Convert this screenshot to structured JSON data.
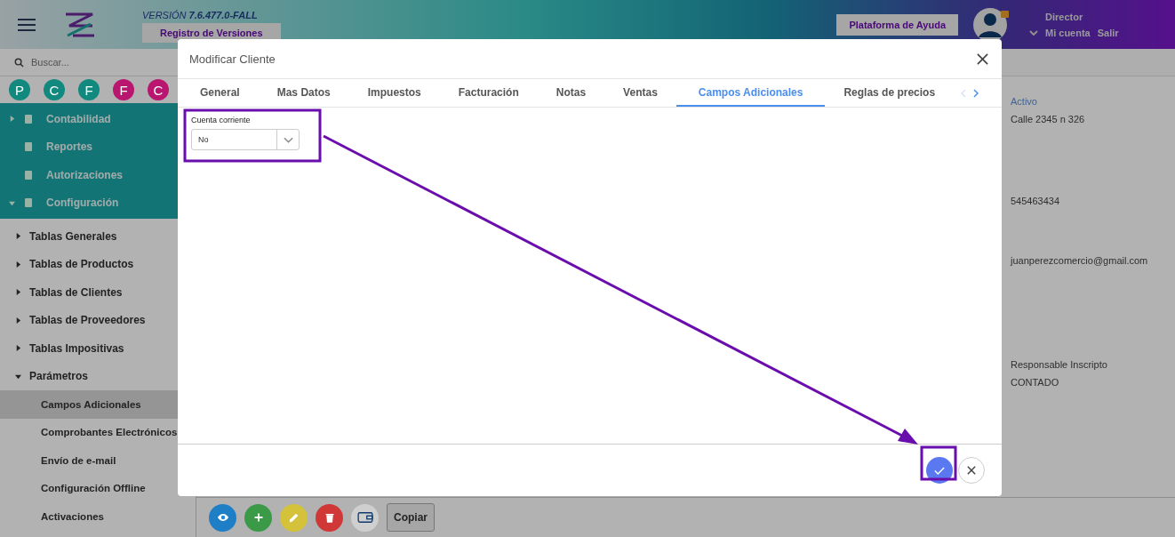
{
  "header": {
    "version": "VERSIÓN **7.6.477.0-FALL**",
    "versions_button": "Registro de Versiones",
    "help_button": "Plataforma de Ayuda",
    "user": {
      "role": "Director",
      "links": [
        "Mi cuenta",
        "Salir"
      ]
    }
  },
  "sidebar": {
    "search": {
      "placeholder": "Buscar..."
    },
    "shortcuts": [
      {
        "letter": "P",
        "color": "#12897f"
      },
      {
        "letter": "C",
        "color": "#12897f"
      },
      {
        "letter": "F",
        "color": "#12897f"
      },
      {
        "letter": "F",
        "color": "#b8166f"
      },
      {
        "letter": "C",
        "color": "#b8166f"
      }
    ],
    "menu": [
      {
        "label": "Contabilidad",
        "kind": "group",
        "expanded": false,
        "selected": false
      },
      {
        "label": "Reportes",
        "kind": "link",
        "selected": false
      },
      {
        "label": "Autorizaciones",
        "kind": "link",
        "selected": false
      },
      {
        "label": "Configuración",
        "kind": "group",
        "expanded": true,
        "selected": false,
        "children": [
          {
            "label": "Tablas Generales",
            "kind": "group",
            "expanded": false,
            "selected": false
          },
          {
            "label": "Tablas de Productos",
            "kind": "group",
            "expanded": false,
            "selected": false
          },
          {
            "label": "Tablas de Clientes",
            "kind": "group",
            "expanded": false,
            "selected": false
          },
          {
            "label": "Tablas de Proveedores",
            "kind": "group",
            "expanded": false,
            "selected": false
          },
          {
            "label": "Tablas Impositivas",
            "kind": "group",
            "expanded": false,
            "selected": false
          },
          {
            "label": "Parámetros",
            "kind": "group",
            "expanded": true,
            "selected": false,
            "children": [
              {
                "label": "Campos Adicionales",
                "selected": true
              },
              {
                "label": "Comprobantes Electrónicos",
                "selected": false
              },
              {
                "label": "Envío de e-mail",
                "selected": false
              },
              {
                "label": "Configuración Offline",
                "selected": false
              },
              {
                "label": "Activaciones",
                "selected": false
              }
            ]
          }
        ]
      }
    ]
  },
  "details": [
    {
      "text": "Activo",
      "kind": "status"
    },
    {
      "text": "Calle 2345 n 326",
      "kind": "text"
    },
    {
      "text": "545463434",
      "kind": "text"
    },
    {
      "text": "juanperezcomercio@gmail.com",
      "kind": "text"
    },
    {
      "text": "Responsable Inscripto",
      "kind": "text"
    },
    {
      "text": "CONTADO",
      "kind": "text"
    }
  ],
  "toolbar": {
    "buttons": [
      {
        "kind": "view",
        "color": "#1f7fc6"
      },
      {
        "kind": "add",
        "color": "#3a9a48"
      },
      {
        "kind": "edit",
        "color": "#d4c23a"
      },
      {
        "kind": "delete",
        "color": "#d03838"
      },
      {
        "kind": "wallet",
        "color": "#cfcfcf"
      }
    ],
    "copy_button": "Copiar"
  },
  "modal": {
    "title": "Modificar Cliente",
    "tabs": [
      {
        "label": "General",
        "selected": false
      },
      {
        "label": "Mas Datos",
        "selected": false
      },
      {
        "label": "Impuestos",
        "selected": false
      },
      {
        "label": "Facturación",
        "selected": false
      },
      {
        "label": "Notas",
        "selected": false
      },
      {
        "label": "Ventas",
        "selected": false
      },
      {
        "label": "Campos Adicionales",
        "selected": true
      },
      {
        "label": "Reglas de precios",
        "selected": false
      }
    ],
    "field": {
      "label": "Cuenta corriente",
      "value": "No"
    }
  }
}
